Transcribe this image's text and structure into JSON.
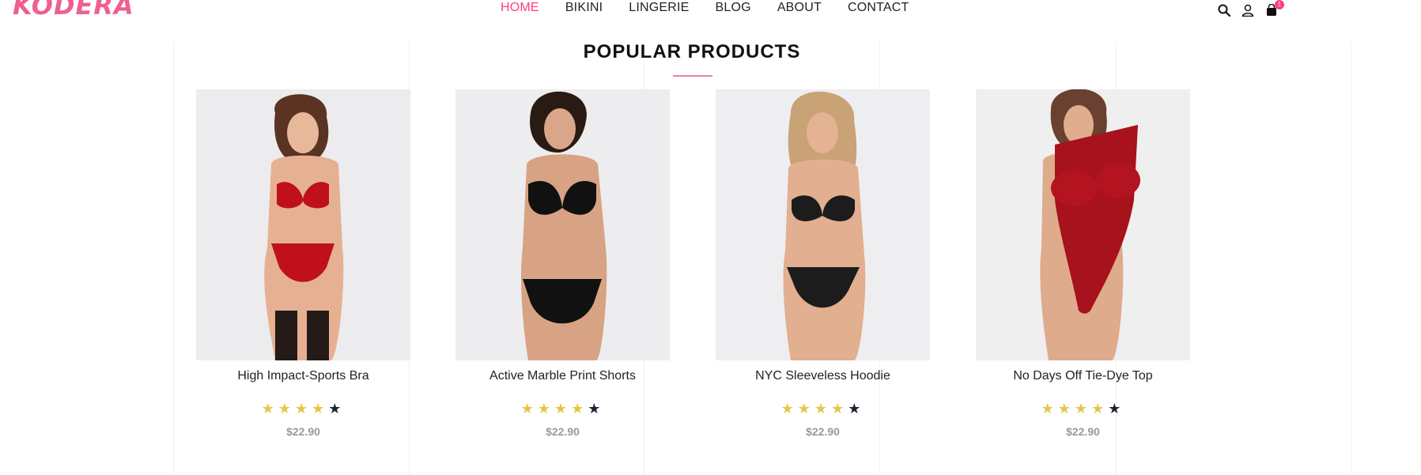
{
  "brand": {
    "logo": "KODERA",
    "accent": "#ff3f7f"
  },
  "nav": [
    {
      "label": "HOME",
      "active": true
    },
    {
      "label": "BIKINI"
    },
    {
      "label": "LINGERIE"
    },
    {
      "label": "BLOG"
    },
    {
      "label": "ABOUT"
    },
    {
      "label": "CONTACT"
    }
  ],
  "header_icons": {
    "search": "search-icon",
    "account": "user-icon",
    "cart": "cart-icon",
    "cart_count": "1"
  },
  "section": {
    "title": "POPULAR PRODUCTS"
  },
  "products": [
    {
      "name": "High Impact-Sports Bra",
      "price": "$22.90",
      "rating": 4,
      "max_rating": 5,
      "garment_color": "#c0101e"
    },
    {
      "name": "Active Marble Print Shorts",
      "price": "$22.90",
      "rating": 4,
      "max_rating": 5,
      "garment_color": "#111111"
    },
    {
      "name": "NYC Sleeveless Hoodie",
      "price": "$22.90",
      "rating": 4,
      "max_rating": 5,
      "garment_color": "#1b1b1b"
    },
    {
      "name": "No Days Off Tie-Dye Top",
      "price": "$22.90",
      "rating": 4,
      "max_rating": 5,
      "garment_color": "#a7121c"
    }
  ]
}
